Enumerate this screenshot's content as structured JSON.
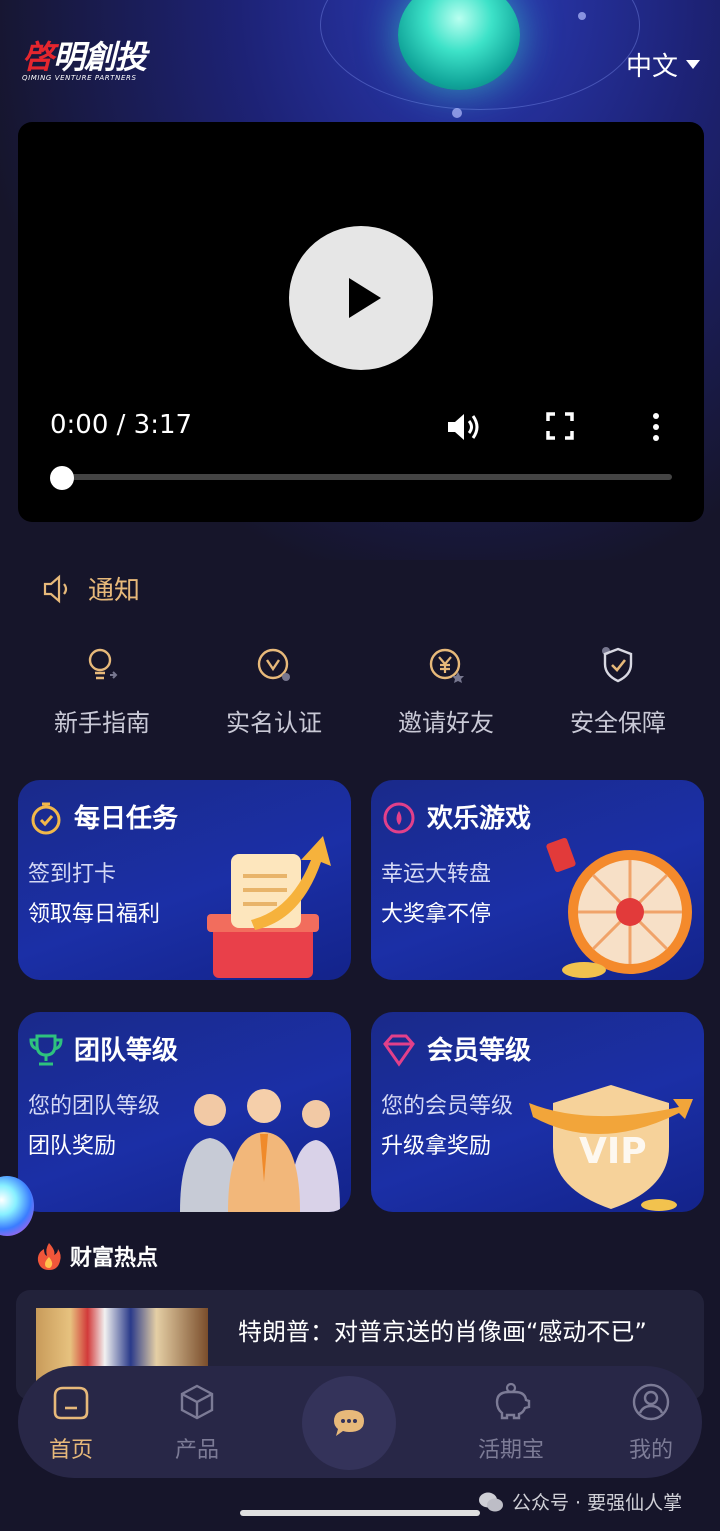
{
  "header": {
    "logo_text_main": "啓明創投",
    "logo_text_sub": "QIMING VENTURE PARTNERS",
    "language": "中文"
  },
  "video": {
    "time": "0:00 / 3:17",
    "progress": 0
  },
  "notice": {
    "label": "通知"
  },
  "quick_links": [
    {
      "label": "新手指南",
      "icon": "lightbulb-icon"
    },
    {
      "label": "实名认证",
      "icon": "verify-icon"
    },
    {
      "label": "邀请好友",
      "icon": "yen-coin-icon"
    },
    {
      "label": "安全保障",
      "icon": "shield-check-icon"
    }
  ],
  "cards": [
    {
      "title": "每日任务",
      "line1": "签到打卡",
      "line2": "领取每日福利",
      "icon": "stopwatch-icon"
    },
    {
      "title": "欢乐游戏",
      "line1": "幸运大转盘",
      "line2": "大奖拿不停",
      "icon": "dial-icon"
    },
    {
      "title": "团队等级",
      "line1": "您的团队等级",
      "line2": "团队奖励",
      "icon": "trophy-icon"
    },
    {
      "title": "会员等级",
      "line1": "您的会员等级",
      "line2": "升级拿奖励",
      "icon": "diamond-icon"
    }
  ],
  "hot": {
    "title": "财富热点",
    "news": [
      {
        "title": "特朗普：对普京送的肖像画“感动不已”"
      }
    ]
  },
  "tabbar": {
    "items": [
      {
        "label": "首页",
        "active": true
      },
      {
        "label": "产品",
        "active": false
      },
      {
        "label": "活期宝",
        "active": false
      },
      {
        "label": "我的",
        "active": false
      }
    ]
  },
  "watermark": "公众号 · 要强仙人掌",
  "colors": {
    "accent": "#e7b97a",
    "background": "#16152a",
    "card": "#1b2fa6"
  }
}
